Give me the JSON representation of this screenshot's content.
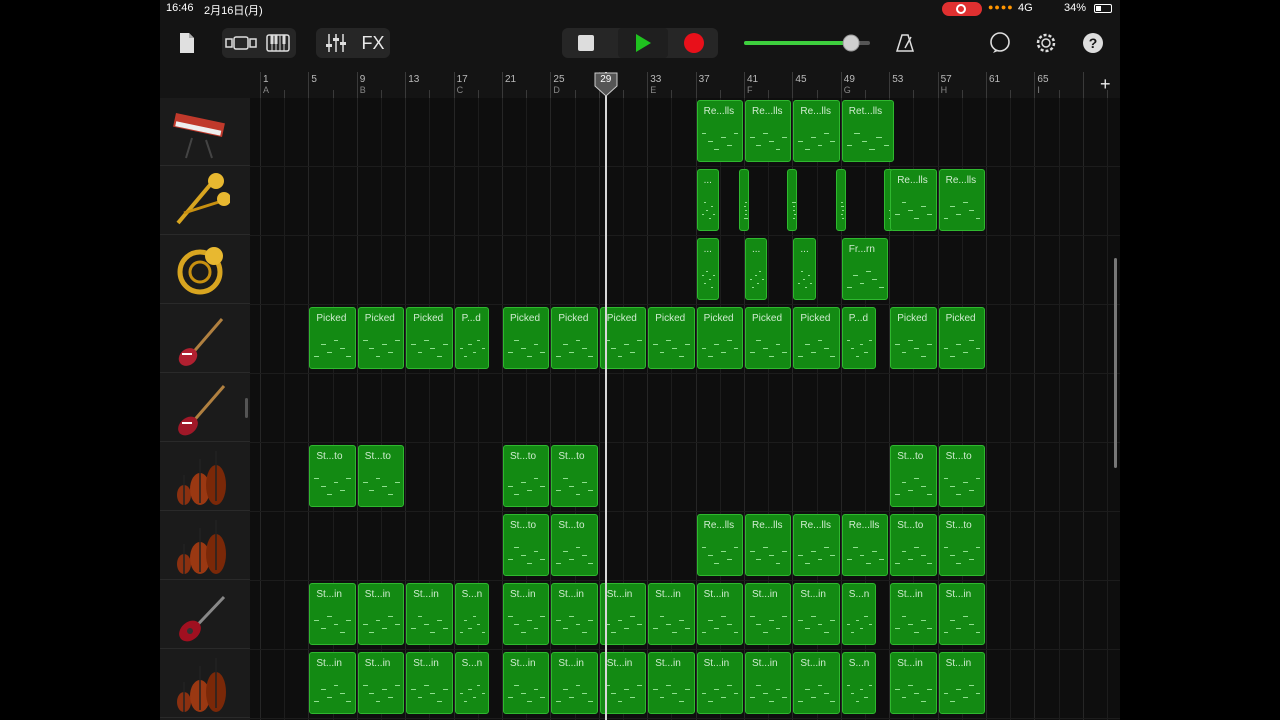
{
  "status": {
    "time": "16:46",
    "date": "2月16日(月)",
    "signal_dots": "●●●●",
    "network": "4G",
    "battery_pct": "34%",
    "battery_level": 0.34
  },
  "toolbar": {
    "fx_label": "FX",
    "master_volume": 0.85,
    "icons": [
      "file-icon",
      "track-view-icon",
      "keyboard-icon",
      "mixer-icon",
      "stop-icon",
      "play-icon",
      "record-icon",
      "metronome-icon",
      "loop-browser-icon",
      "settings-icon",
      "help-icon"
    ],
    "help_label": "?"
  },
  "ruler": {
    "bars": [
      "1",
      "5",
      "9",
      "13",
      "17",
      "21",
      "25",
      "29",
      "33",
      "37",
      "41",
      "45",
      "49",
      "53",
      "57",
      "61",
      "65"
    ],
    "markers": [
      {
        "bar": "1",
        "label": "A"
      },
      {
        "bar": "9",
        "label": "B"
      },
      {
        "bar": "17",
        "label": "C"
      },
      {
        "bar": "25",
        "label": "D"
      },
      {
        "bar": "33",
        "label": "E"
      },
      {
        "bar": "41",
        "label": "F"
      },
      {
        "bar": "49",
        "label": "G"
      },
      {
        "bar": "57",
        "label": "H"
      },
      {
        "bar": "65",
        "label": "I"
      }
    ],
    "playhead_bar": 29,
    "add_label": "+"
  },
  "tracks": [
    {
      "instrument": "synth-keyboard-icon",
      "regions": [
        {
          "start": 37,
          "len": 4,
          "label": "Re...lls"
        },
        {
          "start": 41,
          "len": 4,
          "label": "Re...lls"
        },
        {
          "start": 45,
          "len": 4,
          "label": "Re...lls"
        },
        {
          "start": 49,
          "len": 4.5,
          "label": "Ret...lls"
        }
      ]
    },
    {
      "instrument": "brass-icon",
      "regions": [
        {
          "start": 37,
          "len": 2,
          "label": "..."
        },
        {
          "start": 40.5,
          "len": 1,
          "label": ""
        },
        {
          "start": 44.5,
          "len": 1,
          "label": ""
        },
        {
          "start": 48.5,
          "len": 1,
          "label": ""
        },
        {
          "start": 52.5,
          "len": 1,
          "label": ""
        },
        {
          "start": 53,
          "len": 4,
          "label": "Re...lls"
        },
        {
          "start": 57,
          "len": 4,
          "label": "Re...lls"
        }
      ]
    },
    {
      "instrument": "french-horn-icon",
      "regions": [
        {
          "start": 37,
          "len": 2,
          "label": "..."
        },
        {
          "start": 41,
          "len": 2,
          "label": "..."
        },
        {
          "start": 45,
          "len": 2,
          "label": "..."
        },
        {
          "start": 49,
          "len": 4,
          "label": "Fr...rn"
        }
      ]
    },
    {
      "instrument": "electric-guitar-icon",
      "regions": [
        {
          "start": 5,
          "len": 4,
          "label": "Picked"
        },
        {
          "start": 9,
          "len": 4,
          "label": "Picked"
        },
        {
          "start": 13,
          "len": 4,
          "label": "Picked"
        },
        {
          "start": 17,
          "len": 3,
          "label": "P...d"
        },
        {
          "start": 21,
          "len": 4,
          "label": "Picked"
        },
        {
          "start": 25,
          "len": 4,
          "label": "Picked"
        },
        {
          "start": 29,
          "len": 4,
          "label": "Picked"
        },
        {
          "start": 33,
          "len": 4,
          "label": "Picked"
        },
        {
          "start": 37,
          "len": 4,
          "label": "Picked"
        },
        {
          "start": 41,
          "len": 4,
          "label": "Picked"
        },
        {
          "start": 45,
          "len": 4,
          "label": "Picked"
        },
        {
          "start": 49,
          "len": 3,
          "label": "P...d"
        },
        {
          "start": 53,
          "len": 4,
          "label": "Picked"
        },
        {
          "start": 57,
          "len": 4,
          "label": "Picked"
        }
      ]
    },
    {
      "instrument": "bass-guitar-icon",
      "regions": []
    },
    {
      "instrument": "strings-icon",
      "regions": [
        {
          "start": 5,
          "len": 4,
          "label": "St...to"
        },
        {
          "start": 9,
          "len": 4,
          "label": "St...to"
        },
        {
          "start": 21,
          "len": 4,
          "label": "St...to"
        },
        {
          "start": 25,
          "len": 4,
          "label": "St...to"
        },
        {
          "start": 53,
          "len": 4,
          "label": "St...to"
        },
        {
          "start": 57,
          "len": 4,
          "label": "St...to"
        }
      ]
    },
    {
      "instrument": "strings-icon",
      "regions": [
        {
          "start": 21,
          "len": 4,
          "label": "St...to"
        },
        {
          "start": 25,
          "len": 4,
          "label": "St...to"
        },
        {
          "start": 37,
          "len": 4,
          "label": "Re...lls"
        },
        {
          "start": 41,
          "len": 4,
          "label": "Re...lls"
        },
        {
          "start": 45,
          "len": 4,
          "label": "Re...lls"
        },
        {
          "start": 49,
          "len": 4,
          "label": "Re...lls"
        },
        {
          "start": 53,
          "len": 4,
          "label": "St...to"
        },
        {
          "start": 57,
          "len": 4,
          "label": "St...to"
        }
      ]
    },
    {
      "instrument": "red-guitar-icon",
      "regions": [
        {
          "start": 5,
          "len": 4,
          "label": "St...in"
        },
        {
          "start": 9,
          "len": 4,
          "label": "St...in"
        },
        {
          "start": 13,
          "len": 4,
          "label": "St...in"
        },
        {
          "start": 17,
          "len": 3,
          "label": "S...n"
        },
        {
          "start": 21,
          "len": 4,
          "label": "St...in"
        },
        {
          "start": 25,
          "len": 4,
          "label": "St...in"
        },
        {
          "start": 29,
          "len": 4,
          "label": "St...in"
        },
        {
          "start": 33,
          "len": 4,
          "label": "St...in"
        },
        {
          "start": 37,
          "len": 4,
          "label": "St...in"
        },
        {
          "start": 41,
          "len": 4,
          "label": "St...in"
        },
        {
          "start": 45,
          "len": 4,
          "label": "St...in"
        },
        {
          "start": 49,
          "len": 3,
          "label": "S...n"
        },
        {
          "start": 53,
          "len": 4,
          "label": "St...in"
        },
        {
          "start": 57,
          "len": 4,
          "label": "St...in"
        }
      ]
    },
    {
      "instrument": "strings-icon",
      "regions": [
        {
          "start": 5,
          "len": 4,
          "label": "St...in"
        },
        {
          "start": 9,
          "len": 4,
          "label": "St...in"
        },
        {
          "start": 13,
          "len": 4,
          "label": "St...in"
        },
        {
          "start": 17,
          "len": 3,
          "label": "S...n"
        },
        {
          "start": 21,
          "len": 4,
          "label": "St...in"
        },
        {
          "start": 25,
          "len": 4,
          "label": "St...in"
        },
        {
          "start": 29,
          "len": 4,
          "label": "St...in"
        },
        {
          "start": 33,
          "len": 4,
          "label": "St...in"
        },
        {
          "start": 37,
          "len": 4,
          "label": "St...in"
        },
        {
          "start": 41,
          "len": 4,
          "label": "St...in"
        },
        {
          "start": 45,
          "len": 4,
          "label": "St...in"
        },
        {
          "start": 49,
          "len": 3,
          "label": "S...n"
        },
        {
          "start": 53,
          "len": 4,
          "label": "St...in"
        },
        {
          "start": 57,
          "len": 4,
          "label": "St...in"
        }
      ]
    }
  ],
  "colors": {
    "region_fill": "#138a13",
    "region_border": "#2fb82f",
    "record": "#e8101a",
    "play": "#1fc21f",
    "volume_fill": "#3ecf3e"
  }
}
